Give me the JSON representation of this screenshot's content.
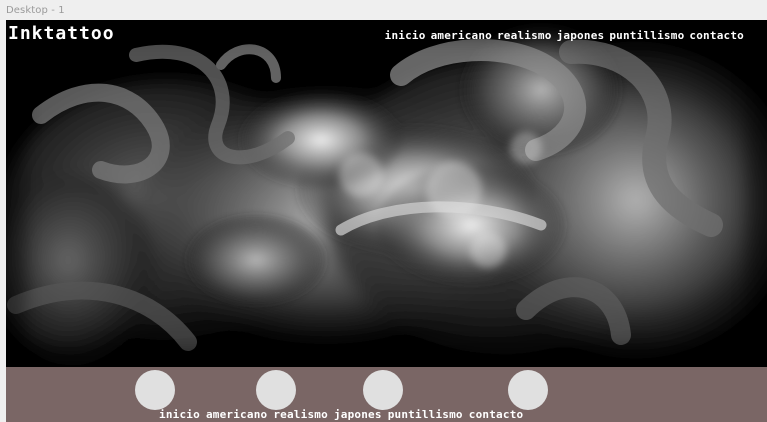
{
  "canvas": {
    "artboard_title": "Desktop - 1"
  },
  "site": {
    "logo": "Inktattoo",
    "top_nav": [
      "inicio",
      "americano",
      "realismo",
      "japones",
      "puntillismo",
      "contacto"
    ],
    "bottom_nav": [
      "inicio",
      "americano",
      "realismo",
      "japones",
      "puntillismo",
      "contacto"
    ]
  },
  "colors": {
    "hero_background": "#000000",
    "footer_background": "#7a6665",
    "circle_fill": "#e0e0e0",
    "nav_text": "#ffffff"
  }
}
